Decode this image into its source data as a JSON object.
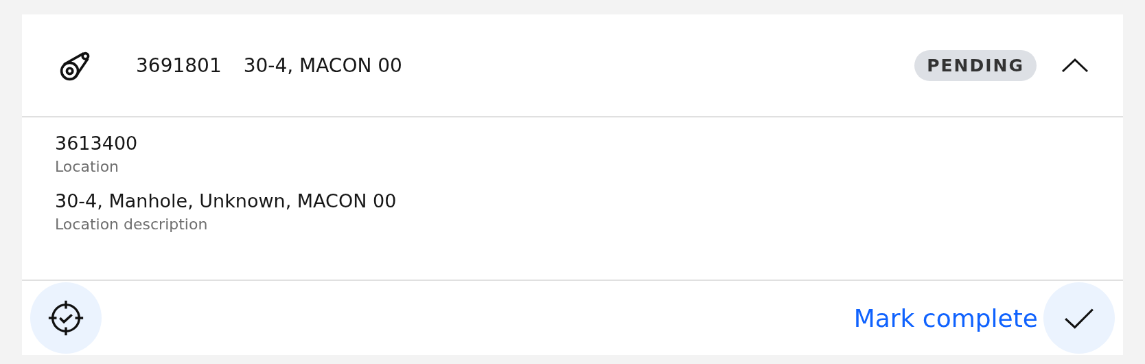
{
  "card": {
    "id": "3691801",
    "title": "30-4, MACON 00",
    "status": "PENDING",
    "expanded": true,
    "fields": [
      {
        "value": "3613400",
        "label": "Location"
      },
      {
        "value": "30-4, Manhole, Unknown, MACON 00",
        "label": "Location description"
      }
    ],
    "action": {
      "label": "Mark complete"
    }
  }
}
